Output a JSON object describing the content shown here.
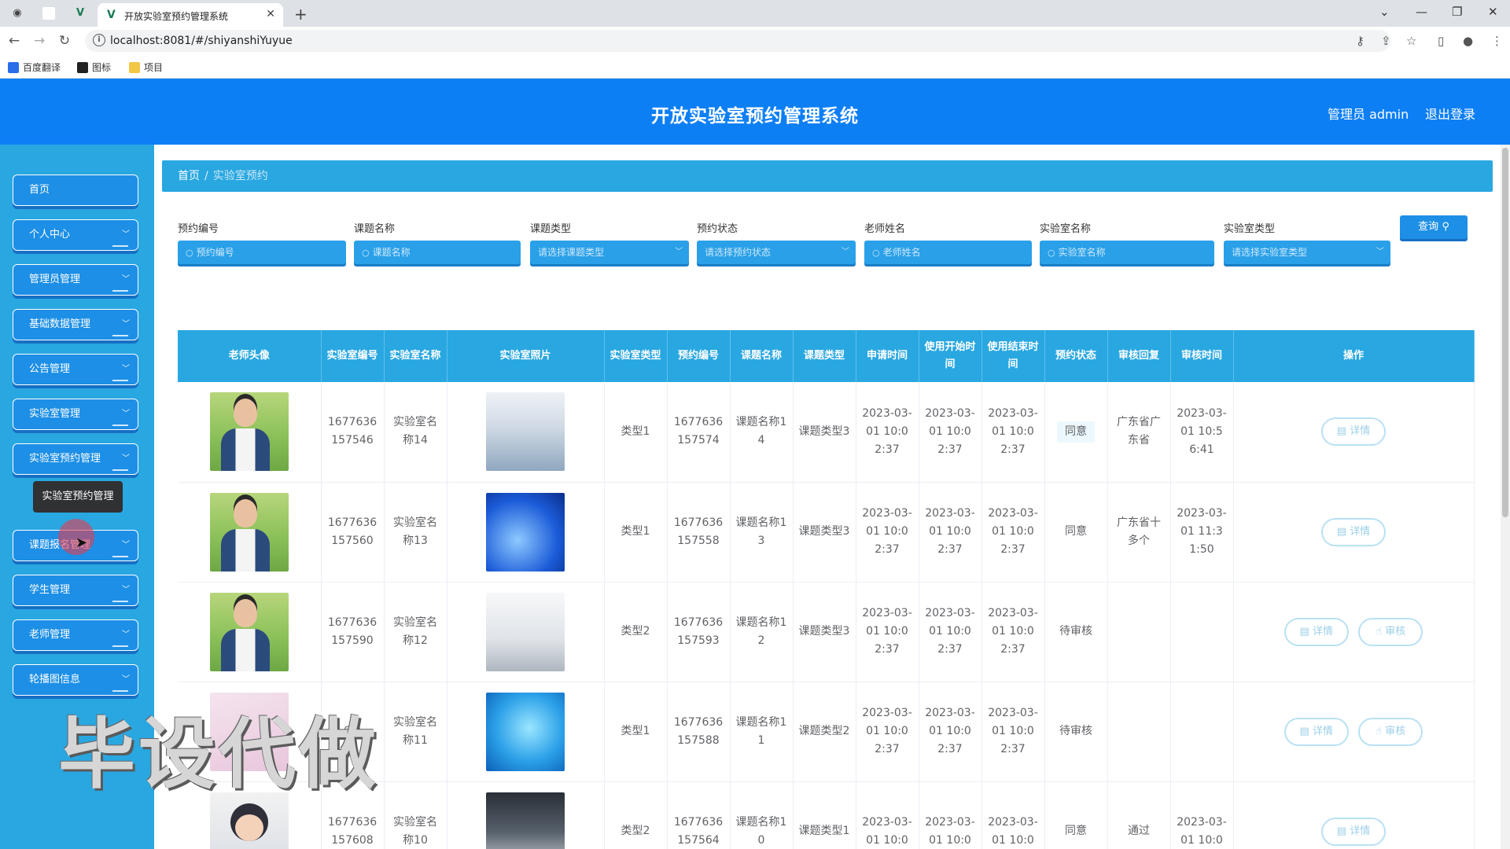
{
  "browser": {
    "tab_title": "开放实验室预约管理系统",
    "url": "localhost:8081/#/shiyanshiYuyue",
    "bookmarks": [
      "百度翻译",
      "图标",
      "项目"
    ]
  },
  "header": {
    "title": "开放实验室预约管理系统",
    "user": "管理员 admin",
    "logout": "退出登录",
    "color": "#0d7ff5"
  },
  "sidebar": {
    "items": [
      "首页",
      "个人中心",
      "管理员管理",
      "基础数据管理",
      "公告管理",
      "实验室管理",
      "实验室预约管理",
      "课题报名管理",
      "学生管理",
      "老师管理",
      "轮播图信息"
    ],
    "tooltip": "实验室预约管理",
    "color": "#29a7e1"
  },
  "breadcrumb": {
    "home": "首页",
    "sep": "/",
    "current": "实验室预约"
  },
  "filters": {
    "fields": [
      {
        "label": "预约编号",
        "placeholder": "预约编号",
        "type": "text"
      },
      {
        "label": "课题名称",
        "placeholder": "课题名称",
        "type": "text"
      },
      {
        "label": "课题类型",
        "placeholder": "请选择课题类型",
        "type": "select"
      },
      {
        "label": "预约状态",
        "placeholder": "请选择预约状态",
        "type": "select"
      },
      {
        "label": "老师姓名",
        "placeholder": "老师姓名",
        "type": "text"
      },
      {
        "label": "实验室名称",
        "placeholder": "实验室名称",
        "type": "text"
      },
      {
        "label": "实验室类型",
        "placeholder": "请选择实验室类型",
        "type": "select"
      }
    ],
    "query_button": "查询"
  },
  "table": {
    "headers": [
      "老师头像",
      "实验室编号",
      "实验室名称",
      "实验室照片",
      "实验室类型",
      "预约编号",
      "课题名称",
      "课题类型",
      "申请时间",
      "使用开始时间",
      "使用结束时间",
      "预约状态",
      "审核回复",
      "审核时间",
      "操作"
    ],
    "rows": [
      {
        "lab_no": "1677636157546",
        "lab_name": "实验室名称14",
        "lab_type": "类型1",
        "booking_no": "1677636157574",
        "topic": "课题名称14",
        "topic_type": "课题类型3",
        "apply_time": "2023-03-01 10:02:37",
        "start_time": "2023-03-01 10:02:37",
        "end_time": "2023-03-01 10:02:37",
        "status": "同意",
        "reply": "广东省广东省",
        "review_time": "2023-03-01 10:56:41",
        "actions": [
          "详情"
        ]
      },
      {
        "lab_no": "1677636157560",
        "lab_name": "实验室名称13",
        "lab_type": "类型1",
        "booking_no": "1677636157558",
        "topic": "课题名称13",
        "topic_type": "课题类型3",
        "apply_time": "2023-03-01 10:02:37",
        "start_time": "2023-03-01 10:02:37",
        "end_time": "2023-03-01 10:02:37",
        "status": "同意",
        "reply": "广东省十多个",
        "review_time": "2023-03-01 11:31:50",
        "actions": [
          "详情"
        ]
      },
      {
        "lab_no": "1677636157590",
        "lab_name": "实验室名称12",
        "lab_type": "类型2",
        "booking_no": "1677636157593",
        "topic": "课题名称12",
        "topic_type": "课题类型3",
        "apply_time": "2023-03-01 10:02:37",
        "start_time": "2023-03-01 10:02:37",
        "end_time": "2023-03-01 10:02:37",
        "status": "待审核",
        "reply": "",
        "review_time": "",
        "actions": [
          "详情",
          "审核"
        ]
      },
      {
        "lab_no": "6 3",
        "lab_name": "实验室名称11",
        "lab_type": "类型1",
        "booking_no": "1677636157588",
        "topic": "课题名称11",
        "topic_type": "课题类型2",
        "apply_time": "2023-03-01 10:02:37",
        "start_time": "2023-03-01 10:02:37",
        "end_time": "2023-03-01 10:02:37",
        "status": "待审核",
        "reply": "",
        "review_time": "",
        "actions": [
          "详情",
          "审核"
        ]
      },
      {
        "lab_no": "1677636157608",
        "lab_name": "实验室名称10",
        "lab_type": "类型2",
        "booking_no": "1677636157564",
        "topic": "课题名称10",
        "topic_type": "课题类型1",
        "apply_time": "2023-03-01 10:0",
        "start_time": "2023-03-01 10:0",
        "end_time": "2023-03-01 10:0",
        "status": "同意",
        "reply": "通过",
        "review_time": "2023-03-01 10:0",
        "actions": [
          "详情"
        ]
      }
    ]
  },
  "watermark": "毕设代做"
}
